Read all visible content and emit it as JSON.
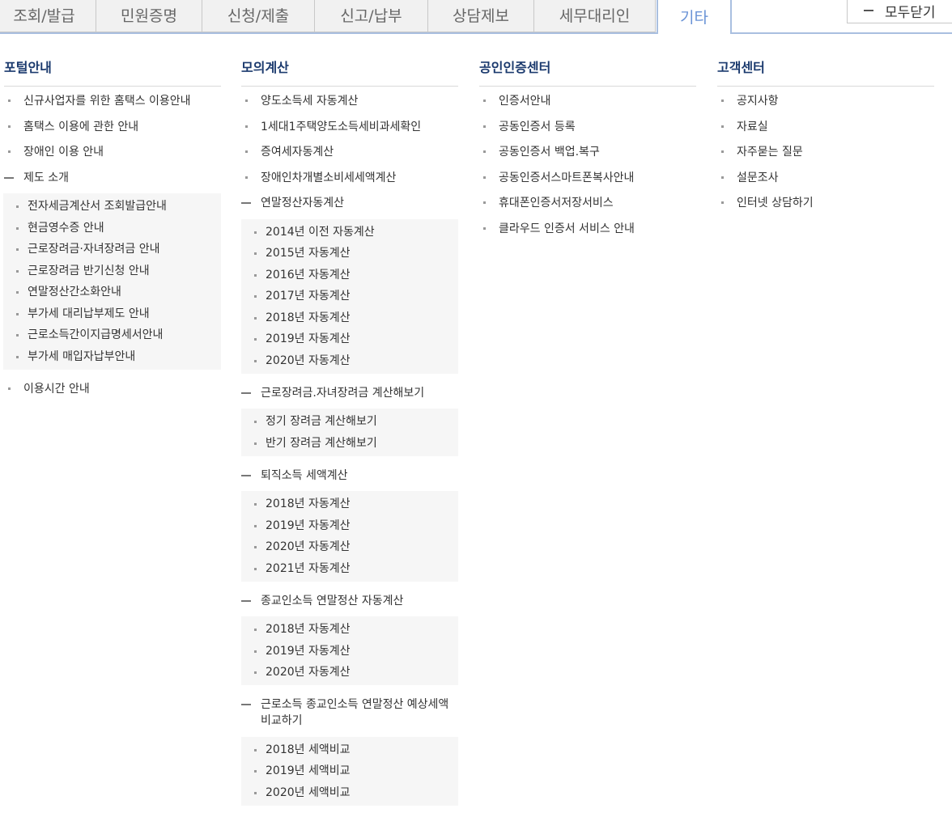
{
  "tabs": [
    {
      "label": "조회/발급"
    },
    {
      "label": "민원증명"
    },
    {
      "label": "신청/제출"
    },
    {
      "label": "신고/납부"
    },
    {
      "label": "상담제보"
    },
    {
      "label": "세무대리인"
    },
    {
      "label": "기타",
      "active": true
    }
  ],
  "close_all_label": "모두닫기",
  "columns": {
    "portal": {
      "title": "포털안내",
      "items": [
        "신규사업자를 위한 홈택스 이용안내",
        "홈택스 이용에 관한 안내",
        "장애인 이용 안내"
      ],
      "group": {
        "label": "제도 소개",
        "items": [
          "전자세금계산서 조회발급안내",
          "현금영수증 안내",
          "근로장려금·자녀장려금 안내",
          "근로장려금 반기신청 안내",
          "연말정산간소화안내",
          "부가세 대리납부제도 안내",
          "근로소득간이지급명세서안내",
          "부가세 매입자납부안내"
        ]
      },
      "after": "이용시간 안내"
    },
    "mock": {
      "title": "모의계산",
      "items": [
        "양도소득세 자동계산",
        "1세대1주택양도소득세비과세확인",
        "증여세자동계산",
        "장애인차개별소비세세액계산"
      ],
      "groups": [
        {
          "label": "연말정산자동계산",
          "items": [
            "2014년 이전 자동계산",
            "2015년 자동계산",
            "2016년 자동계산",
            "2017년 자동계산",
            "2018년 자동계산",
            "2019년 자동계산",
            "2020년 자동계산"
          ]
        },
        {
          "label": "근로장려금.자녀장려금 계산해보기",
          "items": [
            "정기 장려금 계산해보기",
            "반기 장려금 계산해보기"
          ]
        },
        {
          "label": "퇴직소득 세액계산",
          "items": [
            "2018년 자동계산",
            "2019년 자동계산",
            "2020년 자동계산",
            "2021년 자동계산"
          ]
        },
        {
          "label": "종교인소득 연말정산 자동계산",
          "items": [
            "2018년 자동계산",
            "2019년 자동계산",
            "2020년 자동계산"
          ]
        },
        {
          "label": "근로소득 종교인소득 연말정산 예상세액 비교하기",
          "items": [
            "2018년 세액비교",
            "2019년 세액비교",
            "2020년 세액비교"
          ]
        }
      ]
    },
    "cert": {
      "title": "공인인증센터",
      "items": [
        "인증서안내",
        "공동인증서 등록",
        "공동인증서 백업.복구",
        "공동인증서스마트폰복사안내",
        "휴대폰인증서저장서비스",
        "클라우드 인증서 서비스 안내"
      ]
    },
    "customer": {
      "title": "고객센터",
      "items": [
        "공지사항",
        "자료실",
        "자주묻는 질문",
        "설문조사",
        "인터넷 상담하기"
      ]
    }
  }
}
